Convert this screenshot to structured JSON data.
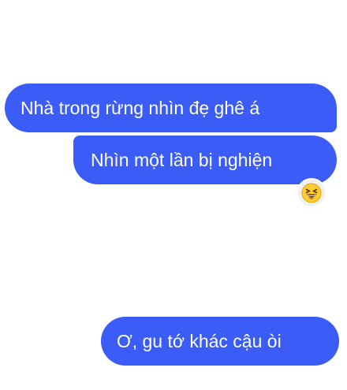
{
  "theme": {
    "accent": "#3b5cf6",
    "bubble_text_color": "#ffffff",
    "background": "#ffffff"
  },
  "messages": [
    {
      "text": "Nhà trong rừng nhìn đẹ ghê á",
      "sender": "self"
    },
    {
      "text": "Nhìn một lần bị nghiện",
      "sender": "self",
      "reaction": "laughing-squint-emoji"
    },
    {
      "text": "Ơ, gu tớ khác cậu òi",
      "sender": "self"
    }
  ]
}
